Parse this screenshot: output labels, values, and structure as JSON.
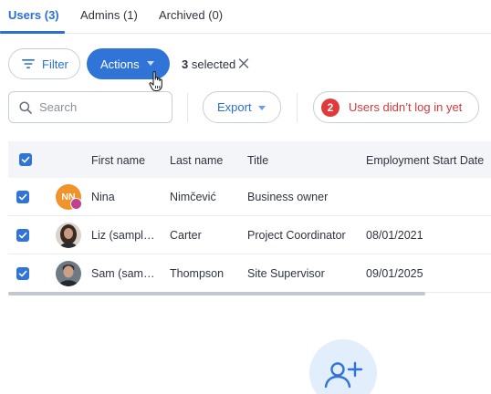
{
  "tabs": [
    {
      "label": "Users (3)"
    },
    {
      "label": "Admins (1)"
    },
    {
      "label": "Archived (0)"
    }
  ],
  "toolbar": {
    "filter_label": "Filter",
    "actions_label": "Actions",
    "selected_count": "3",
    "selected_suffix": "selected",
    "search_placeholder": "Search",
    "export_label": "Export",
    "alert_count": "2",
    "alert_label": "Users didn’t log in yet"
  },
  "table": {
    "columns": [
      "First name",
      "Last name",
      "Title",
      "Employment Start Date"
    ],
    "rows": [
      {
        "initials": "NN",
        "first": "Nina",
        "last": "Nimčević",
        "title": "Business owner",
        "start": ""
      },
      {
        "initials": "",
        "first": "Liz (sampl…",
        "last": "Carter",
        "title": "Project Coordinator",
        "start": "08/01/2021"
      },
      {
        "initials": "",
        "first": "Sam (sam…",
        "last": "Thompson",
        "title": "Site Supervisor",
        "start": "09/01/2025"
      }
    ]
  },
  "colors": {
    "accent": "#2f74d6",
    "alert": "#e03a3a",
    "owner_avatar": "#f0932b",
    "owner_badge": "#c2418c"
  },
  "icons": [
    "filter-icon",
    "caret-down-icon",
    "close-icon",
    "search-icon",
    "check-icon",
    "add-user-icon",
    "hand-cursor-icon"
  ]
}
